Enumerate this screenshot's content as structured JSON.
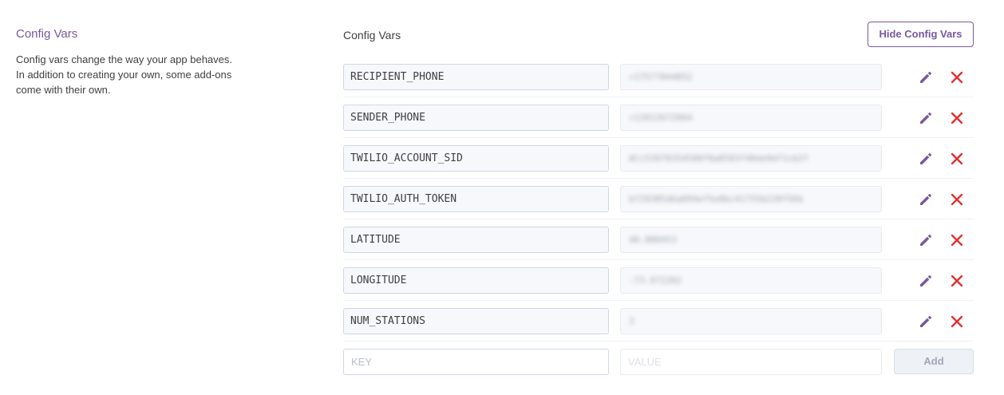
{
  "sidebar": {
    "title": "Config Vars",
    "description": "Config vars change the way your app behaves. In addition to creating your own, some add-ons come with their own."
  },
  "main": {
    "title": "Config Vars",
    "hide_button": "Hide Config Vars",
    "vars": [
      {
        "key": "RECIPIENT_PHONE",
        "value": "+17577844852"
      },
      {
        "key": "SENDER_PHONE",
        "value": "+12012672064"
      },
      {
        "key": "TWILIO_ACCOUNT_SID",
        "value": "ACc53970354588f8a0583f48de9df1cb2f"
      },
      {
        "key": "TWILIO_AUTH_TOKEN",
        "value": "bf28385d6a094ef5e8bc41755b220f56b"
      },
      {
        "key": "LATITUDE",
        "value": "40.880453"
      },
      {
        "key": "LONGITUDE",
        "value": "-73.972262"
      },
      {
        "key": "NUM_STATIONS",
        "value": "3"
      }
    ],
    "new_var": {
      "key_placeholder": "KEY",
      "value_placeholder": "VALUE",
      "add_button": "Add"
    }
  },
  "icons": {
    "edit": "pencil-icon",
    "delete": "close-icon"
  },
  "colors": {
    "accent": "#79589f",
    "danger": "#e32d2d"
  }
}
